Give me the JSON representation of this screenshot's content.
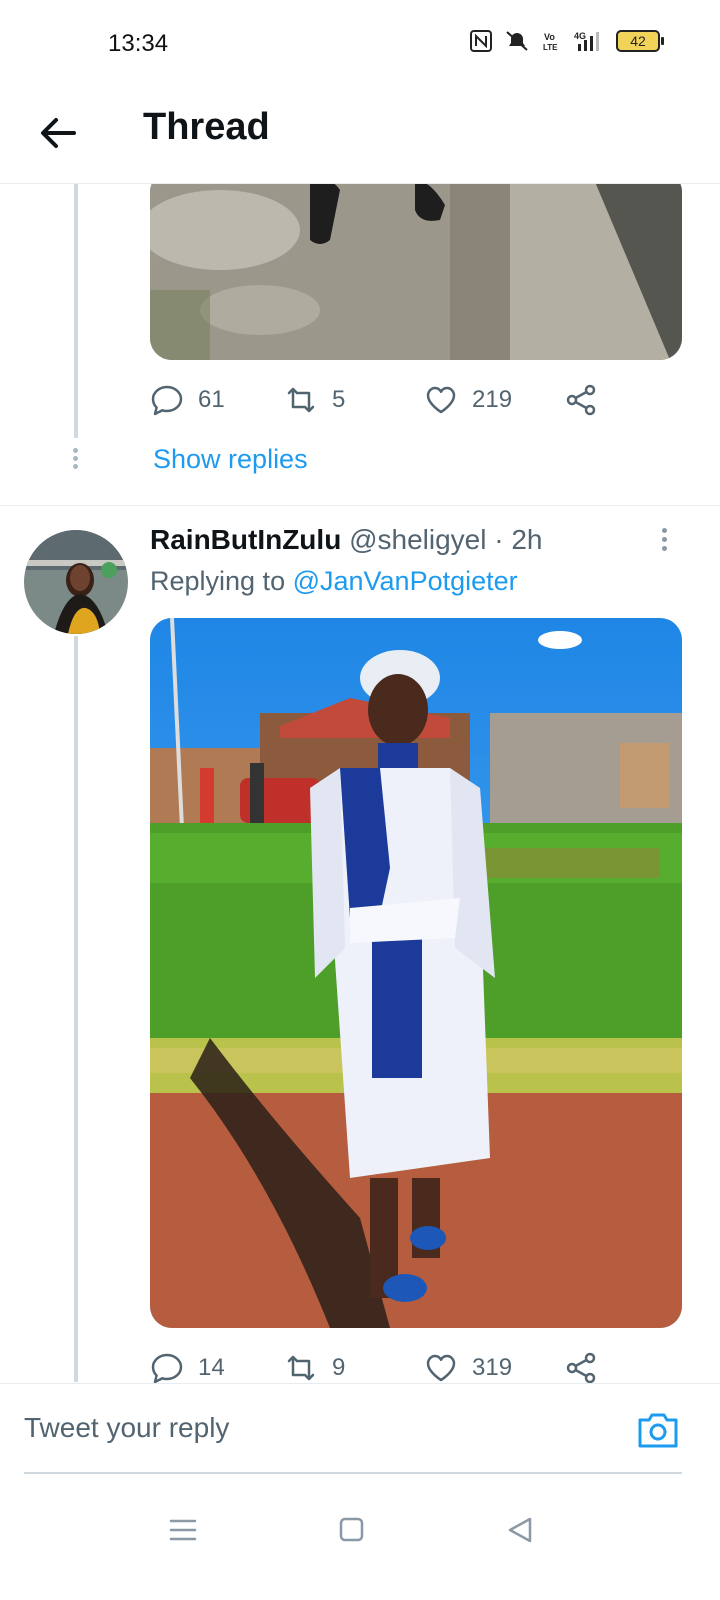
{
  "status_bar": {
    "time": "13:34",
    "battery": "42"
  },
  "header": {
    "title": "Thread"
  },
  "prev_tweet": {
    "counts": {
      "replies": "61",
      "retweets": "5",
      "likes": "219"
    },
    "show_replies": "Show replies"
  },
  "tweet": {
    "name": "RainButInZulu",
    "handle": "@sheligyel",
    "time": "· 2h",
    "replying_prefix": "Replying to ",
    "replying_to": "@JanVanPotgieter",
    "counts": {
      "replies": "14",
      "retweets": "9",
      "likes": "319"
    }
  },
  "composer": {
    "placeholder": "Tweet your reply"
  },
  "icons": {
    "back": "arrow-left-icon",
    "reply": "reply-icon",
    "retweet": "retweet-icon",
    "like": "heart-icon",
    "share": "share-icon",
    "camera": "camera-icon",
    "menu": "menu-icon",
    "home": "home-square-icon",
    "back_nav": "triangle-back-icon"
  },
  "colors": {
    "accent": "#1d9bf0",
    "text_secondary": "#536471"
  }
}
